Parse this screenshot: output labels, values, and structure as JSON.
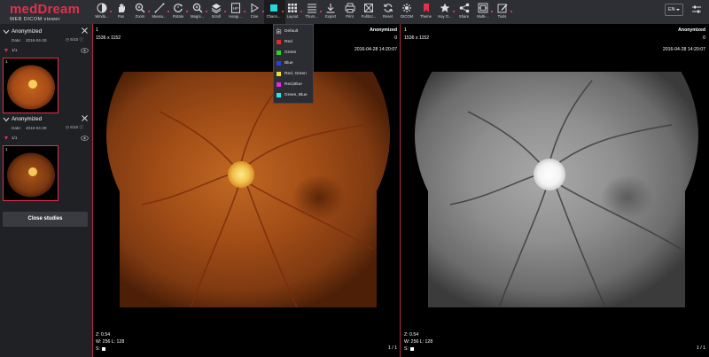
{
  "app": {
    "logo_text": "medDream",
    "logo_subtitle": "WEB DICOM viewer"
  },
  "toolbar": {
    "tools": [
      {
        "label": "Windo...",
        "icon": "window-level-icon",
        "has_caret": true
      },
      {
        "label": "Pan",
        "icon": "hand-pan-icon",
        "has_caret": false
      },
      {
        "label": "Zoom",
        "icon": "zoom-icon",
        "has_caret": true
      },
      {
        "label": "Measu...",
        "icon": "ruler-measure-icon",
        "has_caret": true
      },
      {
        "label": "Rotate",
        "icon": "rotate-icon",
        "has_caret": true
      },
      {
        "label": "Magni...",
        "icon": "magnifier-icon",
        "has_caret": true
      },
      {
        "label": "Scroll",
        "icon": "layers-scroll-icon",
        "has_caret": true
      },
      {
        "label": "Hangi...",
        "icon": "hanging-protocol-icon",
        "has_caret": true
      },
      {
        "label": "Cine",
        "icon": "play-cine-icon",
        "has_caret": true
      },
      {
        "label": "Chann...",
        "icon": "channel-color-icon",
        "has_caret": true,
        "active": true
      },
      {
        "label": "Layout",
        "icon": "grid-layout-icon",
        "has_caret": true
      },
      {
        "label": "Thum...",
        "icon": "thumbnails-icon",
        "has_caret": true
      },
      {
        "label": "Export",
        "icon": "download-export-icon",
        "has_caret": false
      },
      {
        "label": "Print",
        "icon": "printer-icon",
        "has_caret": false
      },
      {
        "label": "FullScr...",
        "icon": "fullscreen-icon",
        "has_caret": false
      },
      {
        "label": "Reset",
        "icon": "reset-icon",
        "has_caret": false
      },
      {
        "label": "DICOM",
        "icon": "dicom-tags-icon",
        "has_caret": false
      },
      {
        "label": "Theme",
        "icon": "theme-icon",
        "has_caret": false
      },
      {
        "label": "Key O...",
        "icon": "key-object-star-icon",
        "has_caret": true
      },
      {
        "label": "Share",
        "icon": "share-icon",
        "has_caret": false
      },
      {
        "label": "Multi-...",
        "icon": "multi-frame-icon",
        "has_caret": true
      },
      {
        "label": "Tools",
        "icon": "edit-tools-icon",
        "has_caret": true
      }
    ],
    "language": "EN",
    "accent_color": "#e2304d"
  },
  "channel_menu": {
    "items": [
      {
        "label": "Default",
        "icon": "default-channel-icon"
      },
      {
        "label": "Red",
        "color": "#e8282b"
      },
      {
        "label": "Green",
        "color": "#2bd02b"
      },
      {
        "label": "Blue",
        "color": "#2b3de8"
      },
      {
        "label": "Red, Green",
        "color": "#e8e22b"
      },
      {
        "label": "Red,Blue",
        "color": "#e22be8"
      },
      {
        "label": "Green, Blue",
        "color": "#2be8e8"
      }
    ]
  },
  "sidebar": {
    "studies": [
      {
        "name": "Anonymized",
        "date_label": "Date:",
        "date": "2016-04-28",
        "frames": "5/10",
        "series_count": "1/1",
        "thumb_number": "1"
      },
      {
        "name": "Anonymized",
        "date_label": "Date:",
        "date": "2016-04-28",
        "frames": "5/10",
        "series_count": "1/1",
        "thumb_number": "1"
      }
    ],
    "close_button": "Close studies"
  },
  "viewports": [
    {
      "number": "1",
      "size": "1536 x 1152",
      "patient": "Anonymized",
      "patient_id": "0",
      "datetime": "2016-04-28 14:20:07",
      "zoom": "Z: 0.54",
      "wl": "W: 256 L: 128",
      "scale": "S:",
      "frame": "1 / 1",
      "mode": "color"
    },
    {
      "number": "1",
      "size": "1536 x 1152",
      "patient": "Anonymized",
      "patient_id": "0",
      "datetime": "2016-04-28 14:20:07",
      "zoom": "Z: 0.54",
      "wl": "W: 256 L: 128",
      "scale": "S:",
      "frame": "1 / 1",
      "mode": "grayscale"
    }
  ]
}
